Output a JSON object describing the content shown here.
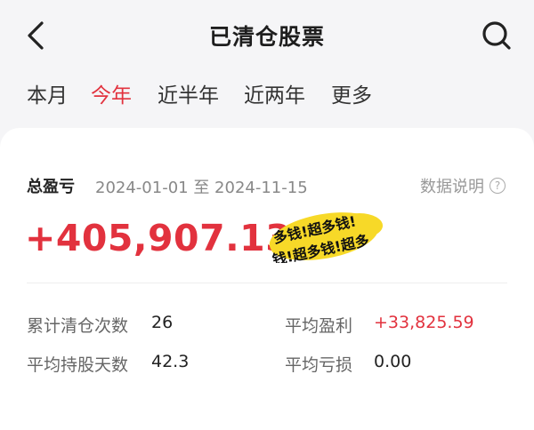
{
  "header": {
    "title": "已清仓股票"
  },
  "tabs": [
    {
      "label": "本月"
    },
    {
      "label": "今年",
      "active": true
    },
    {
      "label": "近半年"
    },
    {
      "label": "近两年"
    },
    {
      "label": "更多"
    }
  ],
  "summary": {
    "label": "总盈亏",
    "date_range": "2024-01-01 至 2024-11-15",
    "data_note": "数据说明",
    "value": "+405,907.13",
    "sticker_line1": "多钱!超多钱!",
    "sticker_line2": "钱!超多钱!超多"
  },
  "stats": {
    "clear_count_label": "累计清仓次数",
    "clear_count_value": "26",
    "avg_profit_label": "平均盈利",
    "avg_profit_value": "+33,825.59",
    "avg_hold_days_label": "平均持股天数",
    "avg_hold_days_value": "42.3",
    "avg_loss_label": "平均亏损",
    "avg_loss_value": "0.00"
  },
  "colors": {
    "accent": "#e2323e",
    "sticker": "#f7d928"
  }
}
